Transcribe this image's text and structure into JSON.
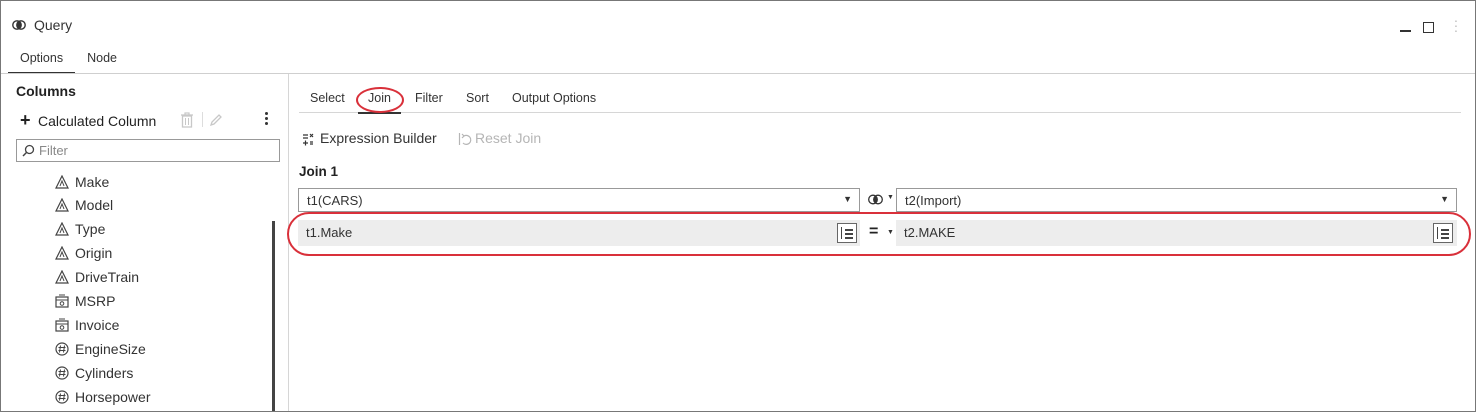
{
  "window": {
    "title": "Query",
    "title_icon": "join-circles-icon",
    "controls": [
      "minimize-icon",
      "maximize-icon",
      "more-vertical-icon"
    ]
  },
  "top_tabs": [
    {
      "label": "Options",
      "active": true
    },
    {
      "label": "Node",
      "active": false
    }
  ],
  "left_panel": {
    "heading": "Columns",
    "calc_column_label": "Calculated Column",
    "filter_placeholder": "Filter",
    "columns": [
      {
        "label": "Make",
        "icon": "character-column-icon"
      },
      {
        "label": "Model",
        "icon": "character-column-icon"
      },
      {
        "label": "Type",
        "icon": "character-column-icon"
      },
      {
        "label": "Origin",
        "icon": "character-column-icon"
      },
      {
        "label": "DriveTrain",
        "icon": "character-column-icon"
      },
      {
        "label": "MSRP",
        "icon": "currency-column-icon"
      },
      {
        "label": "Invoice",
        "icon": "currency-column-icon"
      },
      {
        "label": "EngineSize",
        "icon": "numeric-column-icon"
      },
      {
        "label": "Cylinders",
        "icon": "numeric-column-icon"
      },
      {
        "label": "Horsepower",
        "icon": "numeric-column-icon"
      }
    ]
  },
  "sub_tabs": [
    {
      "label": "Select",
      "active": false
    },
    {
      "label": "Join",
      "active": true
    },
    {
      "label": "Filter",
      "active": false
    },
    {
      "label": "Sort",
      "active": false
    },
    {
      "label": "Output Options",
      "active": false
    }
  ],
  "toolbar": {
    "expression_builder": "Expression Builder",
    "reset_join": "Reset Join"
  },
  "join": {
    "heading": "Join 1",
    "left_table": "t1(CARS)",
    "right_table": "t2(Import)",
    "join_type_icon": "inner-join-icon",
    "condition": {
      "left": "t1.Make",
      "operator": "=",
      "right": "t2.MAKE"
    }
  },
  "annotation_color": "#d9303a"
}
